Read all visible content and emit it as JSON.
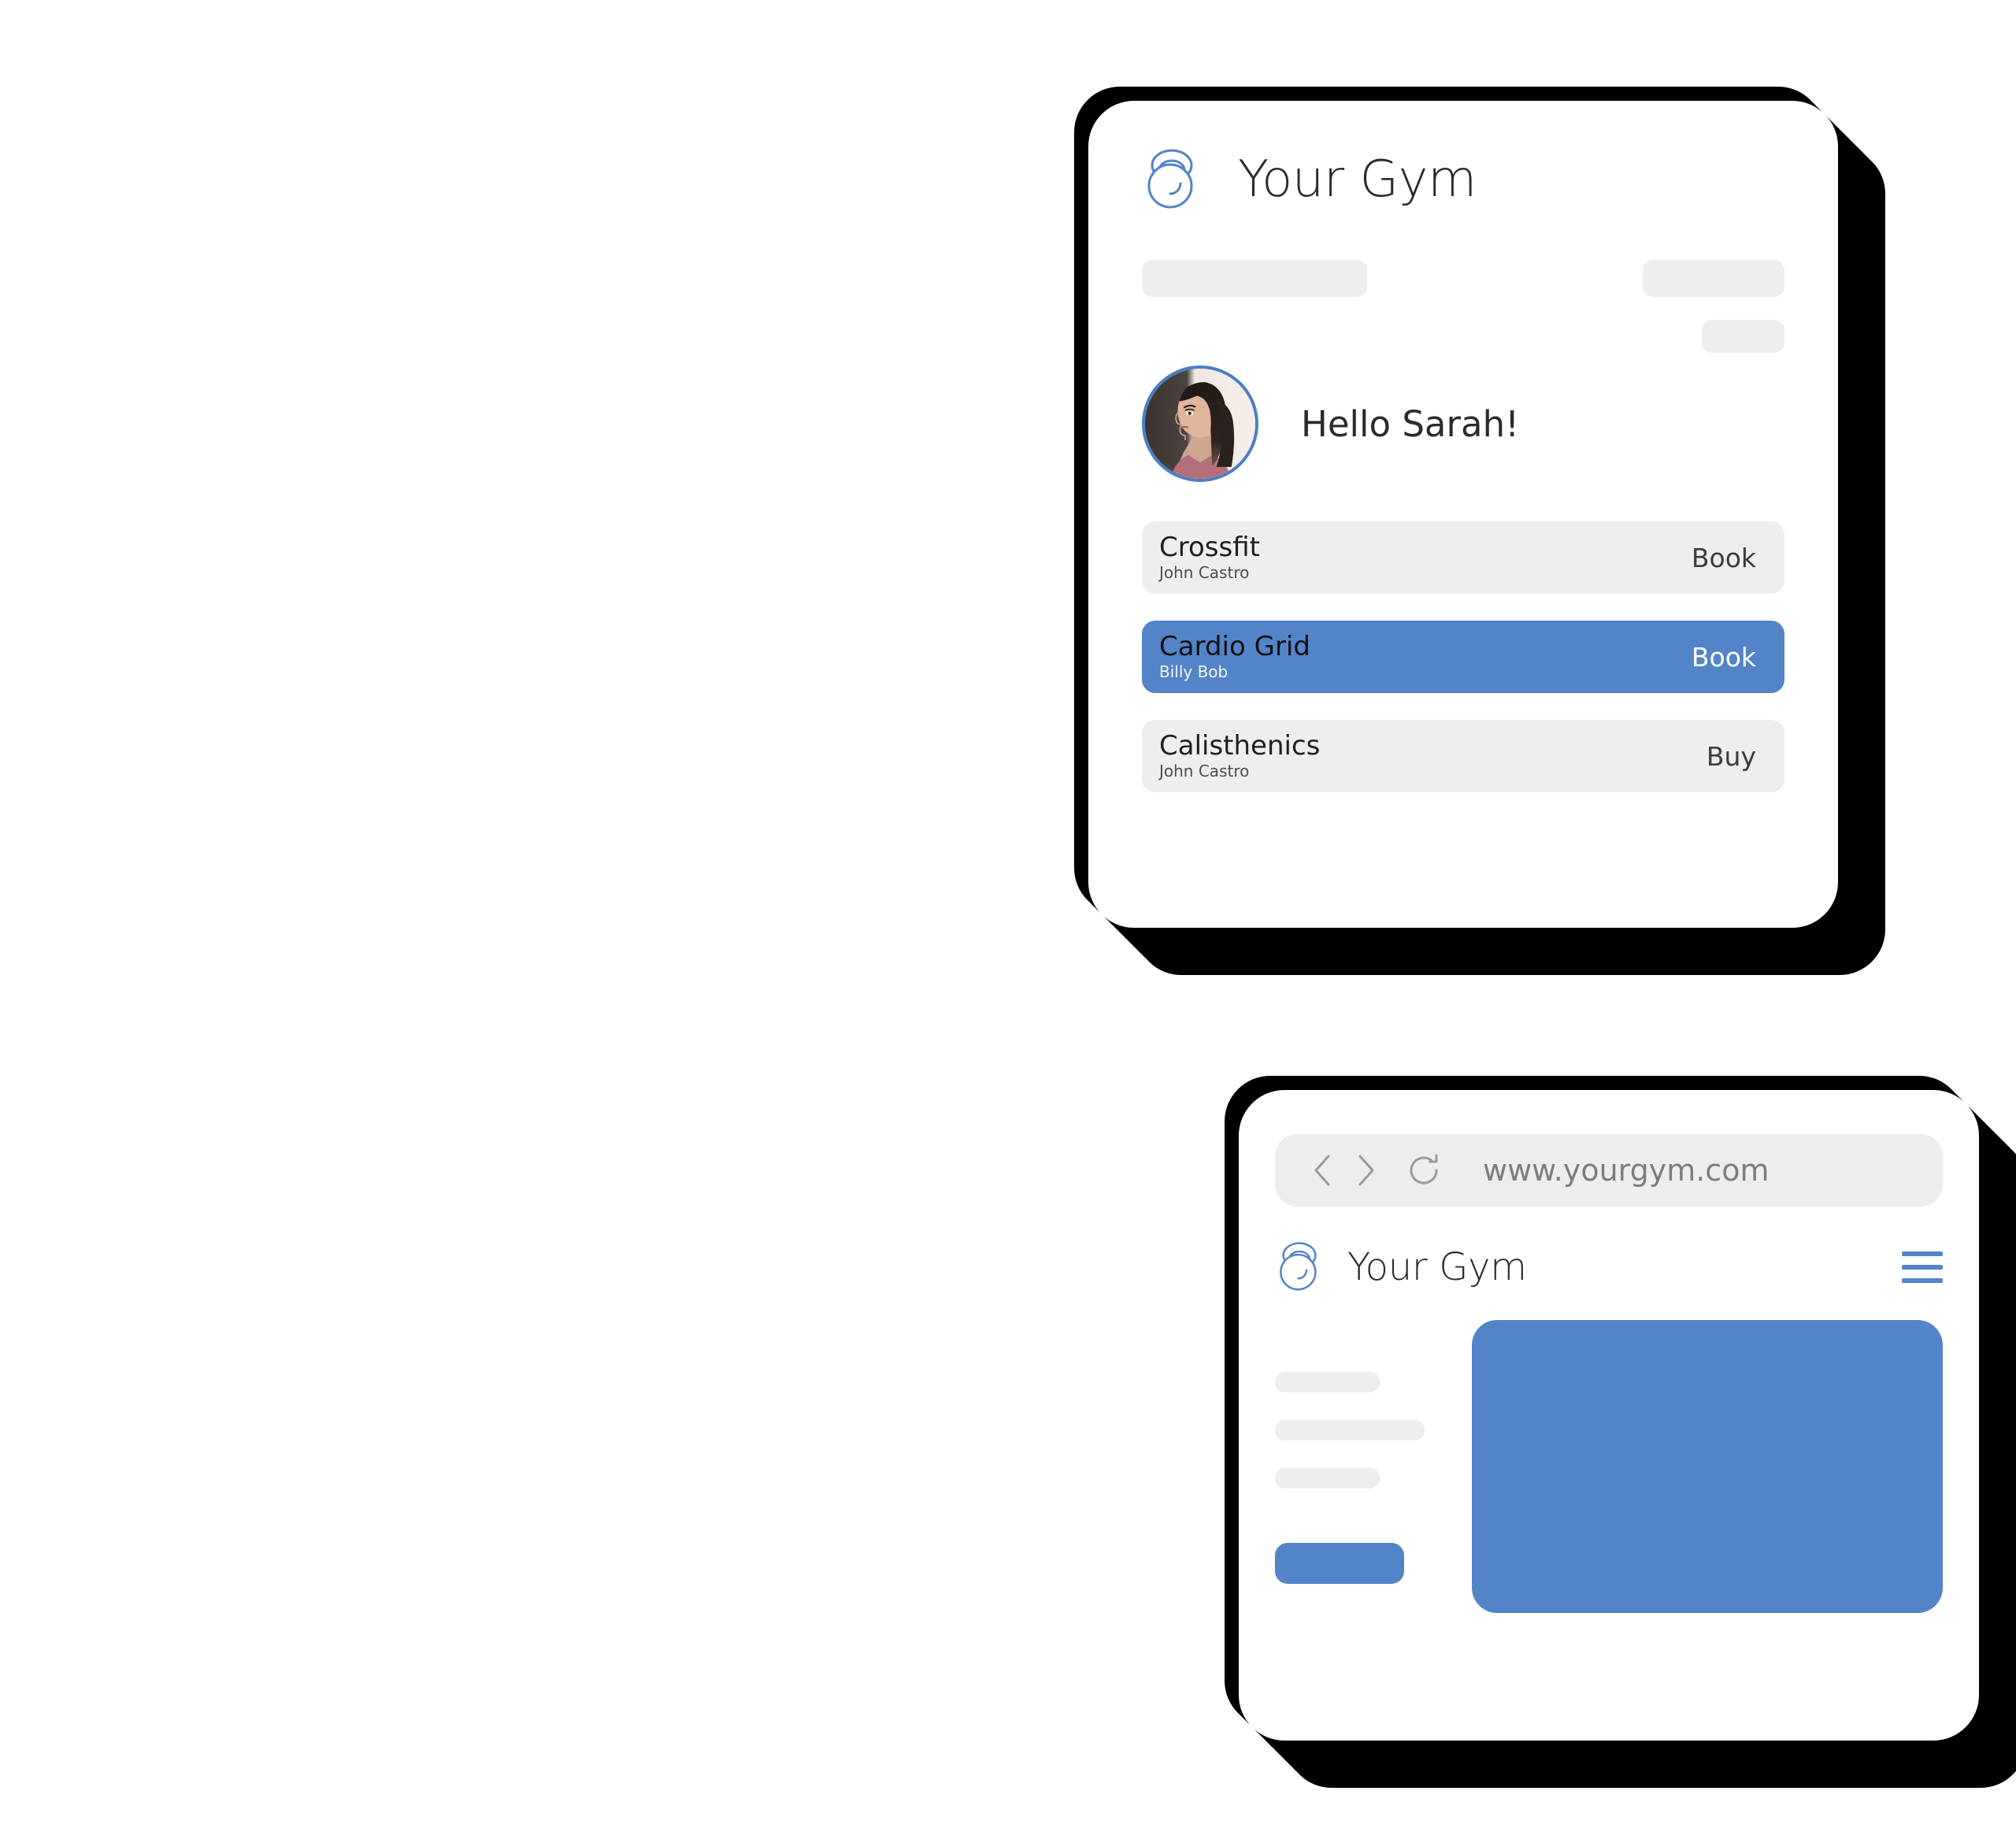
{
  "app_card": {
    "logo_icon": "kettlebell-icon",
    "brand": "Your Gym",
    "greeting": "Hello Sarah!",
    "avatar_icon": "user-photo-avatar",
    "skeletons": [
      "skeleton-bar-left",
      "skeleton-bar-right-top",
      "skeleton-bar-right-bottom"
    ],
    "classes": [
      {
        "name": "Crossfit",
        "coach": "John Castro",
        "action": "Book",
        "active": false
      },
      {
        "name": "Cardio Grid",
        "coach": "Billy Bob",
        "action": "Book",
        "active": true
      },
      {
        "name": "Calisthenics",
        "coach": "John Castro",
        "action": "Buy",
        "active": false
      }
    ]
  },
  "browser_card": {
    "toolbar": {
      "back_icon": "chevron-left-icon",
      "forward_icon": "chevron-right-icon",
      "reload_icon": "reload-icon",
      "url": "www.yourgym.com"
    },
    "site": {
      "logo_icon": "kettlebell-icon",
      "brand": "Your Gym",
      "menu_icon": "hamburger-menu-icon",
      "text_placeholders": [
        "line-1",
        "line-2",
        "line-3"
      ],
      "cta_placeholder": "primary-cta-button",
      "hero_placeholder": "hero-image-block"
    }
  },
  "colors": {
    "accent": "#5384C8",
    "accent_border": "#4A7FC4",
    "surface": "#FFFFFF",
    "muted": "#EEEEEE",
    "toolbar_bg": "#EDEDED",
    "text_primary": "#2B2B2B",
    "text_secondary": "#7D7D7D",
    "shadow": "#000000"
  }
}
